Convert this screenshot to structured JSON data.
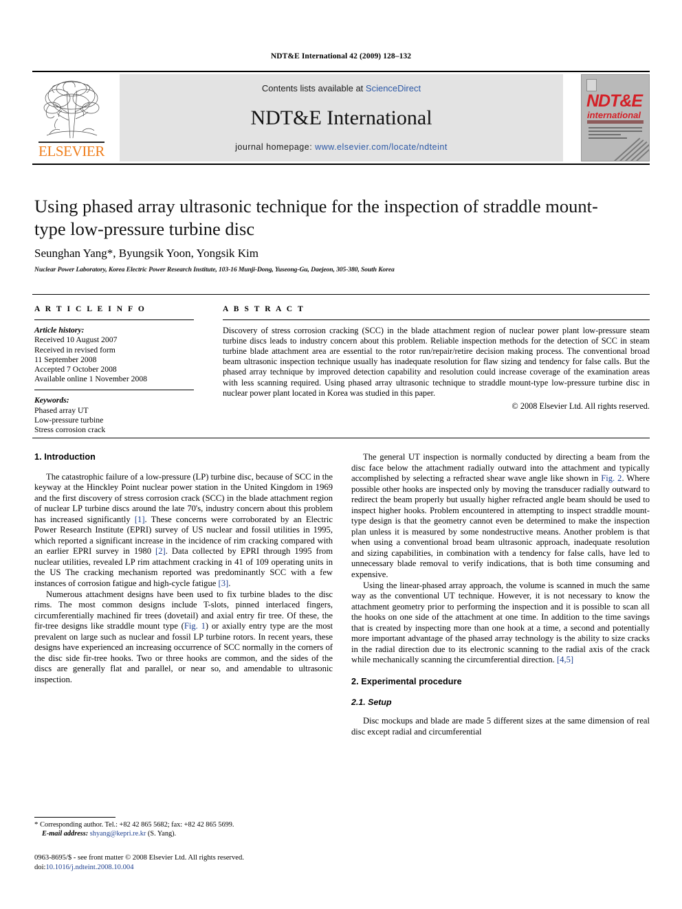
{
  "running_head": "NDT&E International 42 (2009) 128–132",
  "masthead": {
    "publisher_name": "ELSEVIER",
    "contents_prefix": "Contents lists available at ",
    "sciencedirect": "ScienceDirect",
    "journal_title": "NDT&E International",
    "homepage_prefix": "journal homepage: ",
    "homepage_url": "www.elsevier.com/locate/ndteint",
    "cover": {
      "line1": "NDT&E",
      "line2": "international"
    },
    "colors": {
      "elsevier_orange": "#ef7d1a",
      "link_blue": "#2b57a5",
      "panel_grey": "#e3e3e3",
      "cover_red": "#d42027"
    }
  },
  "article": {
    "title": "Using phased array ultrasonic technique for the inspection of straddle mount-type low-pressure turbine disc",
    "authors": "Seunghan Yang*, Byungsik Yoon, Yongsik Kim",
    "affiliation": "Nuclear Power Laboratory, Korea Electric Power Research Institute, 103-16 Munji-Dong, Yuseong-Gu, Daejeon, 305-380, South Korea"
  },
  "article_info": {
    "heading": "A R T I C L E   I N F O",
    "history_label": "Article history:",
    "history": [
      "Received 10 August 2007",
      "Received in revised form",
      "11 September 2008",
      "Accepted 7 October 2008",
      "Available online 1 November 2008"
    ],
    "keywords_label": "Keywords:",
    "keywords": [
      "Phased array UT",
      "Low-pressure turbine",
      "Stress corrosion crack"
    ]
  },
  "abstract": {
    "heading": "A B S T R A C T",
    "text": "Discovery of stress corrosion cracking (SCC) in the blade attachment region of nuclear power plant low-pressure steam turbine discs leads to industry concern about this problem. Reliable inspection methods for the detection of SCC in steam turbine blade attachment area are essential to the rotor run/repair/retire decision making process. The conventional broad beam ultrasonic inspection technique usually has inadequate resolution for flaw sizing and tendency for false calls. But the phased array technique by improved detection capability and resolution could increase coverage of the examination areas with less scanning required. Using phased array ultrasonic technique to straddle mount-type low-pressure turbine disc in nuclear power plant located in Korea was studied in this paper.",
    "copyright": "© 2008 Elsevier Ltd. All rights reserved."
  },
  "body": {
    "section1_heading": "1. Introduction",
    "left_para1_a": "The catastrophic failure of a low-pressure (LP) turbine disc, because of SCC in the keyway at the Hinckley Point nuclear power station in the United Kingdom in 1969 and the first discovery of stress corrosion crack (SCC) in the blade attachment region of nuclear LP turbine discs around the late 70's, industry concern about this problem has increased significantly ",
    "left_para1_ref1": "[1]",
    "left_para1_b": ". These concerns were corroborated by an Electric Power Research Institute (EPRI) survey of US nuclear and fossil utilities in 1995, which reported a significant increase in the incidence of rim cracking compared with an earlier EPRI survey in 1980 ",
    "left_para1_ref2": "[2]",
    "left_para1_c": ". Data collected by EPRI through 1995 from nuclear utilities, revealed LP rim attachment cracking in 41 of 109 operating units in the US The cracking mechanism reported was predominantly SCC with a few instances of corrosion fatigue and high-cycle fatigue ",
    "left_para1_ref3": "[3]",
    "left_para1_d": ".",
    "left_para2_a": "Numerous attachment designs have been used to fix turbine blades to the disc rims. The most common designs include T-slots, pinned interlaced fingers, circumferentially machined fir trees (dovetail) and axial entry fir tree. Of these, the fir-tree designs like straddle mount type (",
    "left_para2_fig": "Fig. 1",
    "left_para2_b": ") or axially entry type are the most prevalent on large such as nuclear and fossil LP turbine rotors. In recent years, these designs have experienced an increasing occurrence of SCC normally in the corners of the disc side fir-tree hooks. Two or three hooks are common, and the sides of the discs are generally flat and parallel, or near so, and amendable to ultrasonic inspection.",
    "right_para1_a": "The general UT inspection is normally conducted by directing a beam from the disc face below the attachment radially outward into the attachment and typically accomplished by selecting a refracted shear wave angle like shown in ",
    "right_para1_fig": "Fig. 2",
    "right_para1_b": ". Where possible other hooks are inspected only by moving the transducer radially outward to redirect the beam properly but usually higher refracted angle beam should be used to inspect higher hooks. Problem encountered in attempting to inspect straddle mount-type design is that the geometry cannot even be determined to make the inspection plan unless it is measured by some nondestructive means. Another problem is that when using a conventional broad beam ultrasonic approach, inadequate resolution and sizing capabilities, in combination with a tendency for false calls, have led to unnecessary blade removal to verify indications, that is both time consuming and expensive.",
    "right_para2_a": "Using the linear-phased array approach, the volume is scanned in much the same way as the conventional UT technique. However, it is not necessary to know the attachment geometry prior to performing the inspection and it is possible to scan all the hooks on one side of the attachment at one time. In addition to the time savings that is created by inspecting more than one hook at a time, a second and potentially more important advantage of the phased array technology is the ability to size cracks in the radial direction due to its electronic scanning to the radial axis of the crack while mechanically scanning the circumferential direction. ",
    "right_para2_ref": "[4,5]",
    "section2_heading": "2. Experimental procedure",
    "subsection21_heading": "2.1. Setup",
    "right_para3": "Disc mockups and blade are made 5 different sizes at the same dimension of real disc except radial and circumferential"
  },
  "footnote": {
    "star": "*",
    "corresponding": " Corresponding author. Tel.: +82 42 865 5682; fax: +82 42 865 5699.",
    "email_label": "E-mail address:",
    "email": "shyang@kepri.re.kr",
    "email_suffix": " (S. Yang)."
  },
  "imprint": {
    "line1": "0963-8695/$ - see front matter © 2008 Elsevier Ltd. All rights reserved.",
    "doi_label": "doi:",
    "doi": "10.1016/j.ndteint.2008.10.004"
  }
}
